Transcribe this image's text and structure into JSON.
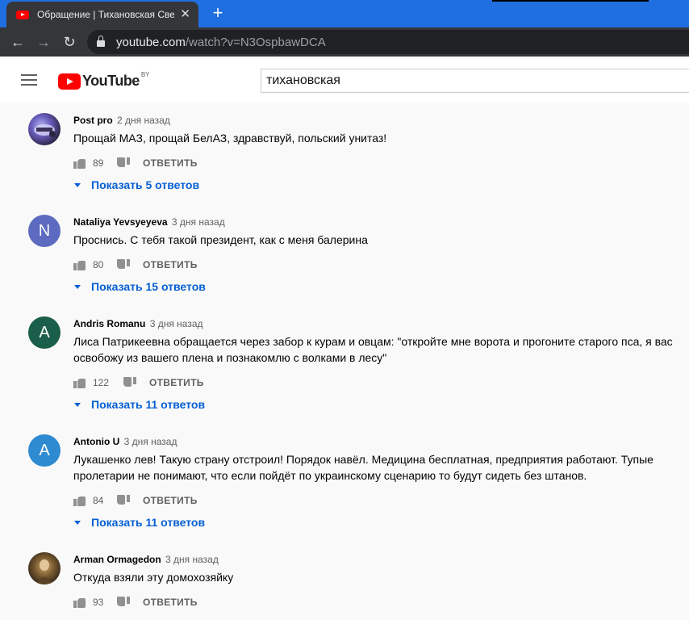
{
  "browser": {
    "tab_title": "Обращение | Тихановская Светл",
    "tab_close": "✕",
    "new_tab": "+",
    "url_host": "youtube.com",
    "url_path": "/watch?v=N3OspbawDCA",
    "nav_back": "←",
    "nav_forward": "→",
    "nav_reload": "↻"
  },
  "header": {
    "logo_text": "YouTube",
    "logo_country": "BY",
    "search_value": "тихановская"
  },
  "colors": {
    "accent_blue": "#065fd4",
    "brand_red": "#ff0000"
  },
  "comments": [
    {
      "author": "Post pro",
      "time": "2 дня назад",
      "text": "Прощай МАЗ, прощай БелАЗ, здравствуй, польский унитаз!",
      "likes": "89",
      "reply_label": "ОТВЕТИТЬ",
      "replies_label": "Показать 5 ответов"
    },
    {
      "author": "Nataliya Yevsyeyeva",
      "time": "3 дня назад",
      "avatar_letter": "N",
      "text": "Проснись. С тебя такой президент, как с меня балерина",
      "likes": "80",
      "reply_label": "ОТВЕТИТЬ",
      "replies_label": "Показать 15 ответов"
    },
    {
      "author": "Andris Romanu",
      "time": "3 дня назад",
      "avatar_letter": "A",
      "text_line1": "Лиса Патрикеевна обращается через забор к курам и овцам: \"откройте мне ворота и прогоните старого пса, я вас",
      "text_line2": "освобожу из вашего плена и познакомлю с волками в лесу\"",
      "likes": "122",
      "reply_label": "ОТВЕТИТЬ",
      "replies_label": "Показать 11 ответов"
    },
    {
      "author": "Antonio U",
      "time": "3 дня назад",
      "avatar_letter": "A",
      "text_line1": "Лукашенко лев! Такую страну отстроил! Порядок навёл. Медицина бесплатная, предприятия работают. Тупые",
      "text_line2": "пролетарии не понимают, что если пойдёт по украинскому сценарию то будут сидеть без штанов.",
      "likes": "84",
      "reply_label": "ОТВЕТИТЬ",
      "replies_label": "Показать 11 ответов"
    },
    {
      "author": "Arman Ormagedon",
      "time": "3 дня назад",
      "text": "Откуда взяли эту домохозяйку",
      "likes": "93",
      "reply_label": "ОТВЕТИТЬ"
    }
  ]
}
